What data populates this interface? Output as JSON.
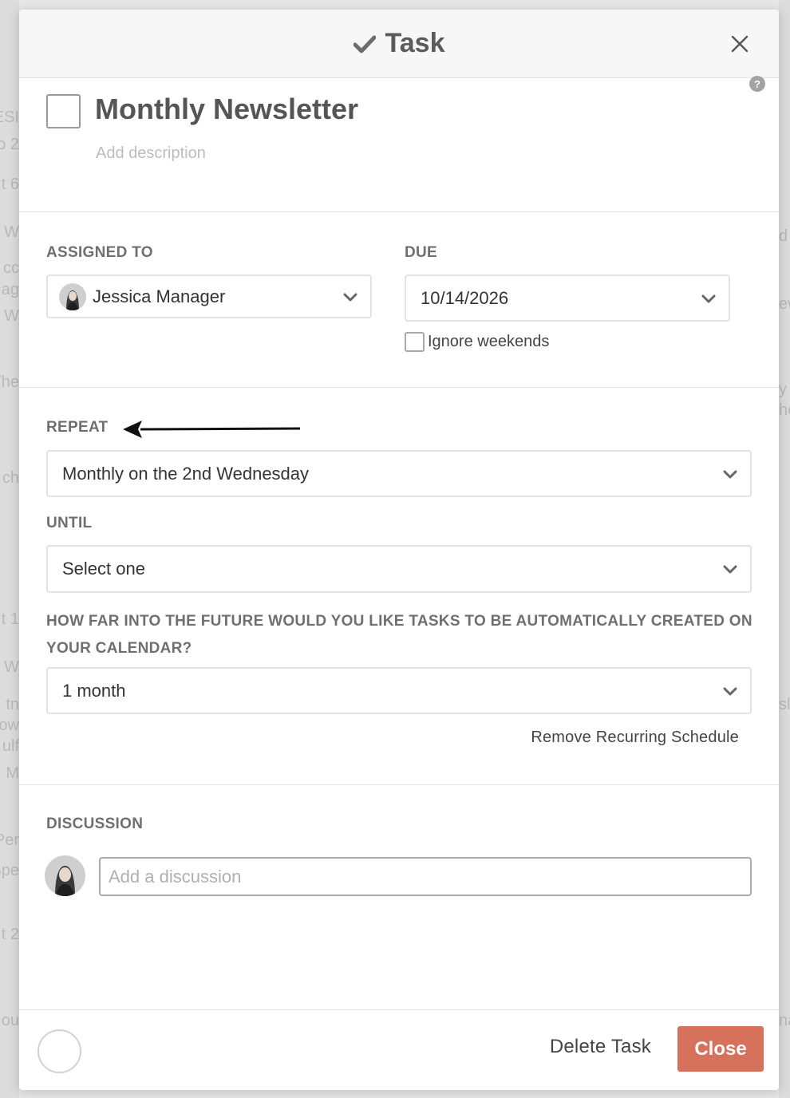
{
  "background": {
    "left_fragments": [
      "ESI",
      "o 2",
      "t 6",
      "W",
      "cc",
      "ag",
      "W",
      "The",
      "ch",
      "t 1",
      "W",
      "tn",
      "ow",
      "ulf",
      "M",
      "Per",
      "Spe",
      "t 2",
      "ou"
    ],
    "right_fragments": [
      "d",
      "ew",
      "y",
      "he",
      "sl",
      "na"
    ]
  },
  "modal": {
    "title": "Task",
    "task_name": "Monthly Newsletter",
    "description_placeholder": "Add description",
    "help": "?"
  },
  "assignment": {
    "assigned_label": "ASSIGNED TO",
    "assignee": "Jessica Manager",
    "due_label": "DUE",
    "due_date": "10/14/2026",
    "ignore_weekends_label": "Ignore weekends"
  },
  "recurrence": {
    "repeat_label": "REPEAT",
    "repeat_value": "Monthly on the 2nd Wednesday",
    "until_label": "UNTIL",
    "until_value": "Select one",
    "future_label": "HOW FAR INTO THE FUTURE WOULD YOU LIKE TASKS TO BE AUTOMATICALLY CREATED ON YOUR CALENDAR?",
    "future_value": "1 month",
    "remove_link": "Remove Recurring Schedule"
  },
  "discussion": {
    "label": "DISCUSSION",
    "placeholder": "Add a discussion"
  },
  "footer": {
    "delete_label": "Delete Task",
    "close_label": "Close"
  },
  "colors": {
    "accent": "#d6715c",
    "header_bg": "#f7f7f7",
    "label": "#6f6f6f"
  }
}
